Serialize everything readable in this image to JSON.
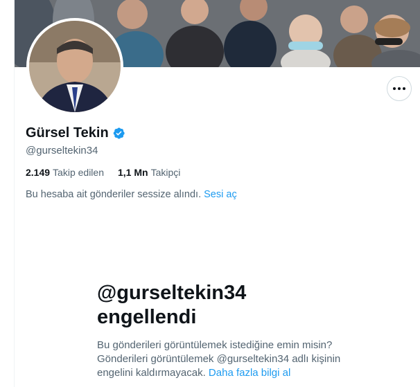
{
  "profile": {
    "display_name": "Gürsel Tekin",
    "handle": "@gurseltekin34",
    "verified": true
  },
  "stats": {
    "following_count": "2.149",
    "following_label": "Takip edilen",
    "followers_count": "1,1 Mn",
    "followers_label": "Takipçi"
  },
  "muted": {
    "message": "Bu hesaba ait gönderiler sessize alındı.",
    "unmute_label": "Sesi aç"
  },
  "blocked": {
    "title_line1": "@gurseltekin34",
    "title_line2": "engellendi",
    "text": "Bu gönderileri görüntülemek istediğine emin misin? Gönderileri görüntülemek @gurseltekin34 adlı kişinin engelini kaldırmayacak.",
    "learn_more_label": "Daha fazla bilgi al"
  },
  "colors": {
    "accent": "#1d9bf0",
    "text_primary": "#0f1419",
    "text_secondary": "#536471",
    "border": "#cfd9de"
  },
  "icons": {
    "more": "more-horizontal-icon",
    "verified": "verified-badge-icon"
  }
}
